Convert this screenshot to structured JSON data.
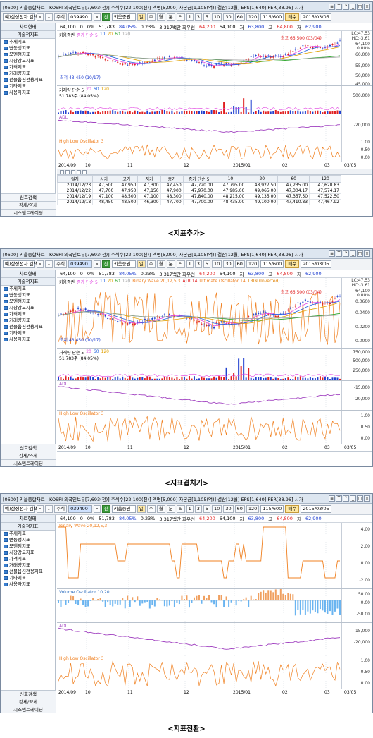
{
  "window": {
    "title": "[0600] 키움종합차트 - KOSPI 외국인보유[7,693(천)] 주식수[22,100(천)] 액면[5,000] 자본금[1,105(억)] 결산[12월] EPS[1,640] PER[38.96] 시가",
    "controls": [
      "≡",
      "T",
      "?",
      "_",
      "□",
      "×"
    ]
  },
  "toolbar": {
    "search": "예)삼성전자 검색",
    "market": "주식",
    "code": "039490",
    "stock": "키움증권",
    "periods": [
      "일",
      "주",
      "월",
      "분",
      "틱"
    ],
    "tick_values": [
      "1",
      "3",
      "5",
      "10",
      "30",
      "60",
      "120"
    ],
    "count": "115/600",
    "buy": "매수",
    "date": "2015/03/05"
  },
  "info": {
    "price": "64,100",
    "change": "0",
    "pct": "0%",
    "volume": "51,783",
    "ratio": "84.05%",
    "rate": "0.23%",
    "mcap": "3,317백만 회우선",
    "v1": "64,200",
    "v2": "64,100",
    "low_label": "저",
    "low": "63,800",
    "high_label": "고",
    "high": "64,800",
    "close_label": "저",
    "close": "62,900"
  },
  "sidebar": {
    "header1": "차트형태",
    "header2": "기술적지표",
    "items": [
      "추세지표",
      "변동성지표",
      "모멘텀지표",
      "시장강도지표",
      "가격지표",
      "거래량지표",
      "선물옵션전용지표",
      "기타지표",
      "사용자지표"
    ],
    "footer": [
      "신호검색",
      "강세/약세",
      "시스템트레이딩"
    ]
  },
  "panels": [
    {
      "caption": "<지표추가>",
      "price_legend": [
        "키움증권",
        "종가 단순 5",
        "10",
        "20",
        "60",
        "120"
      ],
      "price_ticks": [
        "LC:47.53",
        "HC:-3.61",
        "64,100",
        "0.00%",
        "60,000",
        "55,000",
        "50,000",
        "45,000"
      ],
      "annot_high": "최고 66,500 (03/04)",
      "annot_low": "최저 43,450 (10/17)",
      "vol_legend": [
        "거래량 단순 5",
        "20",
        "60",
        "120"
      ],
      "vol_text": "51,783주 (84.05%)",
      "vol_ticks": [
        "500,000"
      ],
      "adl_legend": "ADL",
      "adl_ticks": [
        "-20,000"
      ],
      "hlo_legend": "High Low Oscillator 3",
      "hlo_ticks": [
        "1.00",
        "0.50",
        "0.00"
      ],
      "xlabels": [
        "2014/09",
        "10",
        "11",
        "12",
        "2015/01",
        "02",
        "03",
        "03/05"
      ],
      "table_headers": [
        "일자",
        "시가",
        "고가",
        "저가",
        "종가",
        "종가 단순 5",
        "10",
        "20",
        "60",
        "120"
      ],
      "table_rows": [
        [
          "2014/12/23",
          "47,500",
          "47,950",
          "47,300",
          "47,450",
          "47,720.00",
          "47,795.00",
          "48,927.50",
          "47,235.00",
          "47,620.83"
        ],
        [
          "2014/12/22",
          "47,700",
          "47,950",
          "47,150",
          "47,900",
          "47,970.00",
          "47,985.00",
          "49,065.00",
          "47,304.17",
          "47,574.17"
        ],
        [
          "2014/12/19",
          "47,100",
          "48,500",
          "47,100",
          "48,300",
          "47,840.00",
          "48,215.00",
          "49,135.00",
          "47,357.50",
          "47,522.50"
        ],
        [
          "2014/12/18",
          "48,450",
          "48,500",
          "46,300",
          "47,700",
          "47,700.00",
          "48,435.00",
          "49,100.00",
          "47,410.83",
          "47,467.92"
        ]
      ]
    },
    {
      "caption": "<지표겹치기>",
      "price_legend": [
        "키움증권",
        "종가 단순 5",
        "10",
        "20",
        "60",
        "120",
        "Binary Wave 20,12,5,3",
        "ATR 14",
        "Ultimate Oscillator 14",
        "TRIN (Inverted)"
      ],
      "price_ticks": [
        "LC:47.53",
        "HC:-3.61",
        "64,100",
        "0.00%",
        "0.0600",
        "0.0400",
        "0.0200",
        "0.0000"
      ],
      "annot_high": "최고 66,500 (03/04)",
      "annot_low": "최저 43,450 (10/17)",
      "vol_legend": [
        "거래량 단순 5",
        "20",
        "60",
        "120"
      ],
      "vol_text": "51,783주 (84.05%)",
      "vol_ticks": [
        "750,000",
        "500,000",
        "250,000"
      ],
      "adl_legend": "ADL",
      "adl_ticks": [
        "-15,000",
        "-20,000"
      ],
      "hlo_legend": "High Low Oscillator 3",
      "hlo_ticks": [
        "1.00",
        "0.50",
        "0.00"
      ],
      "xlabels": [
        "2014/09",
        "10",
        "11",
        "12",
        "2015/01",
        "02",
        "03",
        "03/05"
      ]
    },
    {
      "caption": "<지표전환>",
      "bw_legend": "Binary Wave 20,12,5,3",
      "bw_ticks": [
        "4.00",
        "2.00",
        "0.00",
        "-2.00"
      ],
      "vo_legend": "Volume Oscillator 10,20",
      "vo_ticks": [
        "50.00",
        "0.00",
        "-50.00"
      ],
      "adl_legend": "ADL",
      "adl_ticks": [
        "-15,000",
        "-20,000"
      ],
      "hlo_legend": "High Low Oscillator 3",
      "hlo_ticks": [
        "1.00",
        "0.50",
        "0.00"
      ],
      "xlabels": [
        "2014/09",
        "10",
        "11",
        "12",
        "2015/01",
        "02",
        "03",
        "03/05"
      ]
    }
  ],
  "colors": {
    "up": "#e02020",
    "down": "#2040d0",
    "ma5": "#e040e0",
    "ma10": "#2060e0",
    "ma20": "#e0a000",
    "ma60": "#20a020",
    "ma120": "#a0a0a0",
    "orange": "#f08020",
    "purple": "#a040c0",
    "sky": "#6ab4f0"
  }
}
